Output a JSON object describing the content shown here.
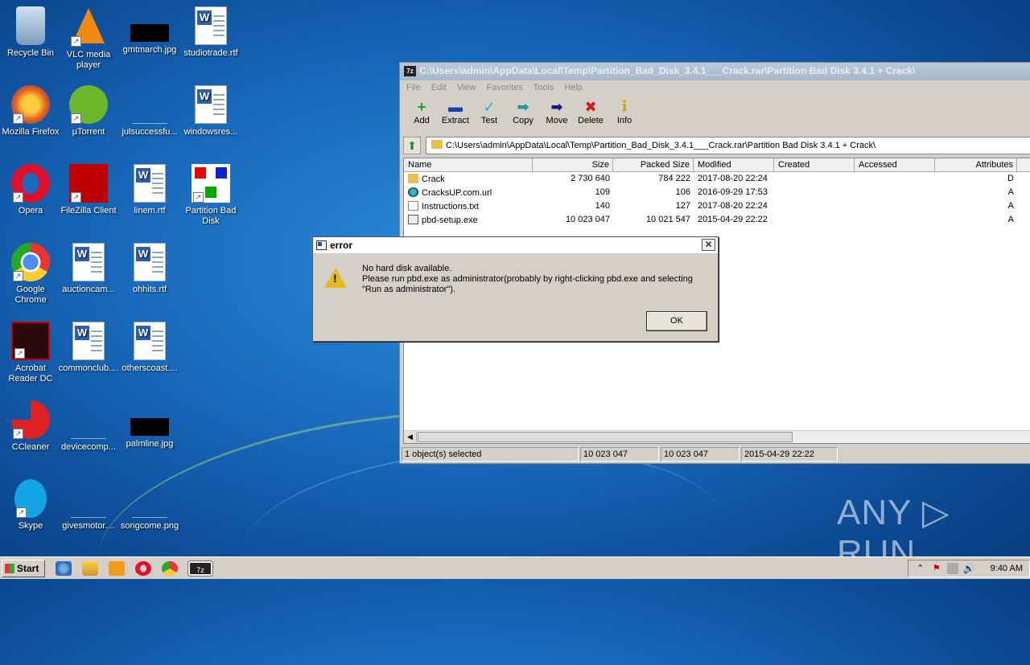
{
  "desktop": {
    "icons": [
      {
        "label": "Recycle Bin"
      },
      {
        "label": "VLC media player"
      },
      {
        "label": "gmtmarch.jpg"
      },
      {
        "label": "studiotrade.rtf"
      },
      {
        "label": "Mozilla Firefox"
      },
      {
        "label": "µTorrent"
      },
      {
        "label": "julsuccessfu..."
      },
      {
        "label": "windowsres..."
      },
      {
        "label": "Opera"
      },
      {
        "label": "FileZilla Client"
      },
      {
        "label": "linem.rtf"
      },
      {
        "label": "Partition Bad Disk"
      },
      {
        "label": "Google Chrome"
      },
      {
        "label": "auctioncam..."
      },
      {
        "label": "ohhits.rtf"
      },
      {
        "label": "Acrobat Reader DC"
      },
      {
        "label": "commonclub...."
      },
      {
        "label": "otherscoast...."
      },
      {
        "label": "CCleaner"
      },
      {
        "label": "devicecomp..."
      },
      {
        "label": "palmline.jpg"
      },
      {
        "label": "Skype"
      },
      {
        "label": "givesmotor...."
      },
      {
        "label": "songcome.png"
      }
    ]
  },
  "sevenzip": {
    "app_icon": "7z",
    "title": "C:\\Users\\admin\\AppData\\Local\\Temp\\Partition_Bad_Disk_3.4.1___Crack.rar\\Partition Bad Disk 3.4.1 + Crack\\",
    "menu": [
      "File",
      "Edit",
      "View",
      "Favorites",
      "Tools",
      "Help"
    ],
    "toolbar": [
      {
        "label": "Add",
        "icon": "plus-icon",
        "glyph": "+",
        "color": "#1aa31a"
      },
      {
        "label": "Extract",
        "icon": "minus-icon",
        "glyph": "▬",
        "color": "#1a3bb5"
      },
      {
        "label": "Test",
        "icon": "check-icon",
        "glyph": "✓",
        "color": "#1fb3c7"
      },
      {
        "label": "Copy",
        "icon": "copy-arrow-icon",
        "glyph": "➡",
        "color": "#1a9a9a"
      },
      {
        "label": "Move",
        "icon": "move-arrow-icon",
        "glyph": "➡",
        "color": "#101c80"
      },
      {
        "label": "Delete",
        "icon": "delete-x-icon",
        "glyph": "✖",
        "color": "#d11a1a"
      },
      {
        "label": "Info",
        "icon": "info-icon",
        "glyph": "i",
        "color": "#c7a400"
      }
    ],
    "address": "C:\\Users\\admin\\AppData\\Local\\Temp\\Partition_Bad_Disk_3.4.1___Crack.rar\\Partition Bad Disk 3.4.1 + Crack\\",
    "columns": [
      "Name",
      "Size",
      "Packed Size",
      "Modified",
      "Created",
      "Accessed",
      "Attributes"
    ],
    "rows": [
      {
        "name": "Crack",
        "size": "2 730 640",
        "packed": "784 222",
        "modified": "2017-08-20 22:24",
        "created": "",
        "accessed": "",
        "attr": "D",
        "type": "folder"
      },
      {
        "name": "CracksUP.com.url",
        "size": "109",
        "packed": "106",
        "modified": "2016-09-29 17:53",
        "created": "",
        "accessed": "",
        "attr": "A",
        "type": "url"
      },
      {
        "name": "Instructions.txt",
        "size": "140",
        "packed": "127",
        "modified": "2017-08-20 22:24",
        "created": "",
        "accessed": "",
        "attr": "A",
        "type": "txt"
      },
      {
        "name": "pbd-setup.exe",
        "size": "10 023 047",
        "packed": "10 021 547",
        "modified": "2015-04-29 22:22",
        "created": "",
        "accessed": "",
        "attr": "A",
        "type": "exe"
      }
    ],
    "status": {
      "selected": "1 object(s) selected",
      "size": "10 023 047",
      "packed": "10 023 047",
      "modified": "2015-04-29 22:22"
    }
  },
  "dialog": {
    "title": "error",
    "close_glyph": "✕",
    "warning_glyph": "!",
    "line1": "No hard disk available.",
    "line2": "Please run pbd.exe as administrator(probably by right-clicking pbd.exe and selecting",
    "line3": "\"Run as administrator\").",
    "ok_label": "OK"
  },
  "watermark": "ANY ▷ RUN",
  "taskbar": {
    "start_label": "Start",
    "apps": [
      "internet-explorer-icon",
      "explorer-icon",
      "media-player-icon",
      "opera-icon",
      "chrome-icon",
      "7zip-icon"
    ],
    "seven_zip_glyph": "7z",
    "tray_glyphs": {
      "chevron": "⌃",
      "flag": "⚑",
      "volume": "🔊"
    },
    "clock": "9:40 AM"
  }
}
